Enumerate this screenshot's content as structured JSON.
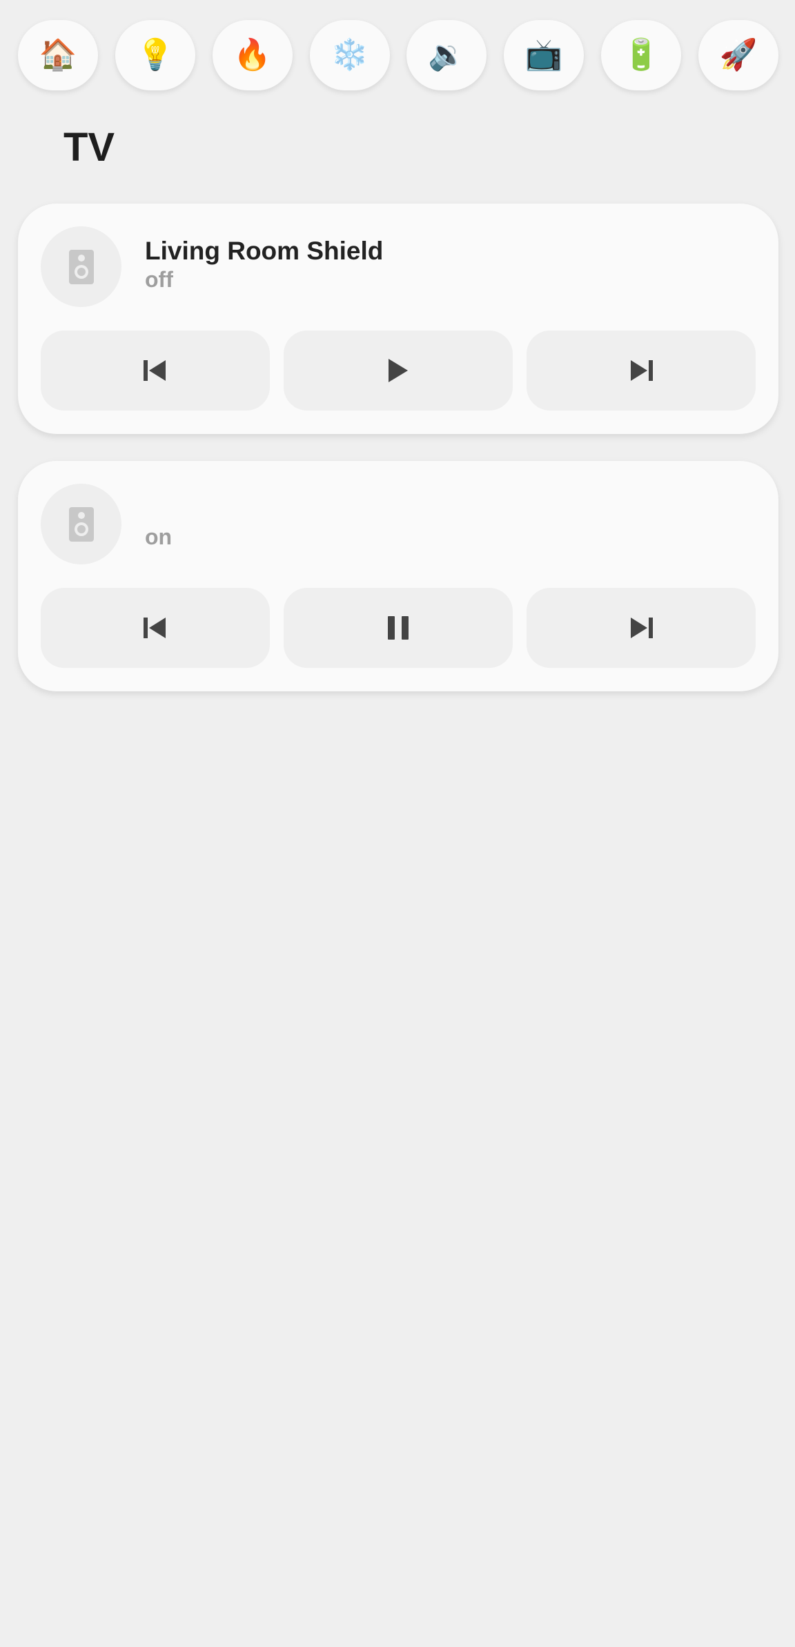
{
  "nav": {
    "items": [
      {
        "name": "home",
        "glyph": "🏠"
      },
      {
        "name": "lights",
        "glyph": "💡"
      },
      {
        "name": "heating",
        "glyph": "🔥"
      },
      {
        "name": "cooling",
        "glyph": "❄️"
      },
      {
        "name": "speaker",
        "glyph": "🔉"
      },
      {
        "name": "tv",
        "glyph": "📺"
      },
      {
        "name": "battery",
        "glyph": "🔋"
      },
      {
        "name": "rocket",
        "glyph": "🚀"
      }
    ]
  },
  "page": {
    "title": "TV"
  },
  "players": [
    {
      "name": "Living Room Shield",
      "state": "off",
      "icon": "speaker-icon",
      "controls": [
        "previous-icon",
        "play-icon",
        "next-icon"
      ]
    },
    {
      "name": "",
      "state": "on",
      "icon": "speaker-icon",
      "controls": [
        "previous-icon",
        "pause-icon",
        "next-icon"
      ]
    }
  ],
  "colors": {
    "background": "#efefef",
    "card": "#fafafa",
    "button": "#efefef",
    "icon": "#444444",
    "muted": "#9e9e9e"
  }
}
